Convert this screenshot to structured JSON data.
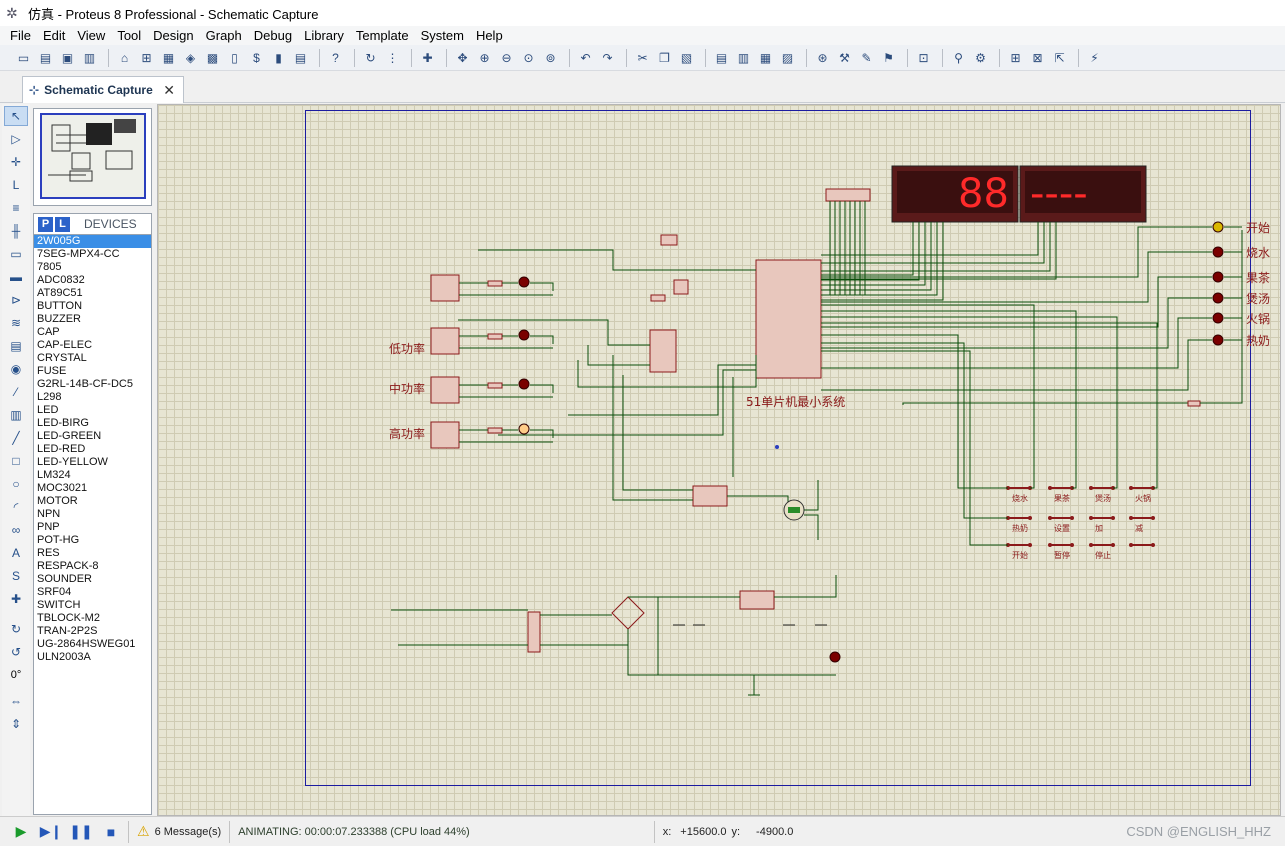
{
  "title": "仿真 - Proteus 8 Professional - Schematic Capture",
  "menu": [
    "File",
    "Edit",
    "View",
    "Tool",
    "Design",
    "Graph",
    "Debug",
    "Library",
    "Template",
    "System",
    "Help"
  ],
  "tab": {
    "label": "Schematic Capture"
  },
  "device_panel": {
    "p_label": "P",
    "l_label": "L",
    "header": "DEVICES"
  },
  "devices": [
    "2W005G",
    "7SEG-MPX4-CC",
    "7805",
    "ADC0832",
    "AT89C51",
    "BUTTON",
    "BUZZER",
    "CAP",
    "CAP-ELEC",
    "CRYSTAL",
    "FUSE",
    "G2RL-14B-CF-DC5",
    "L298",
    "LED",
    "LED-BIRG",
    "LED-GREEN",
    "LED-RED",
    "LED-YELLOW",
    "LM324",
    "MOC3021",
    "MOTOR",
    "NPN",
    "PNP",
    "POT-HG",
    "RES",
    "RESPACK-8",
    "SOUNDER",
    "SRF04",
    "SWITCH",
    "TBLOCK-M2",
    "TRAN-2P2S",
    "UG-2864HSWEG01",
    "ULN2003A"
  ],
  "rotation_label": "0°",
  "schematic": {
    "seg_display_left": "88",
    "seg_display_right": "----",
    "mcu_label": "51单片机最小系统",
    "power_labels": [
      "低功率",
      "中功率",
      "高功率"
    ],
    "mode_labels": [
      "开始",
      "烧水",
      "果茶",
      "煲汤",
      "火锅",
      "热奶"
    ],
    "button_labels_row1": [
      "烧水",
      "果茶",
      "煲汤",
      "火锅"
    ],
    "button_labels_row2": [
      "热奶",
      "设置",
      "加",
      "减"
    ],
    "button_labels_row3": [
      "开始",
      "暂停",
      "停止",
      ""
    ]
  },
  "status": {
    "messages": "6 Message(s)",
    "animating": "ANIMATING: 00:00:07.233388 (CPU load 44%)",
    "x_label": "x:",
    "x_value": "+15600.0",
    "y_label": "y:",
    "y_value": "-4900.0",
    "watermark": "CSDN @ENGLISH_HHZ"
  }
}
